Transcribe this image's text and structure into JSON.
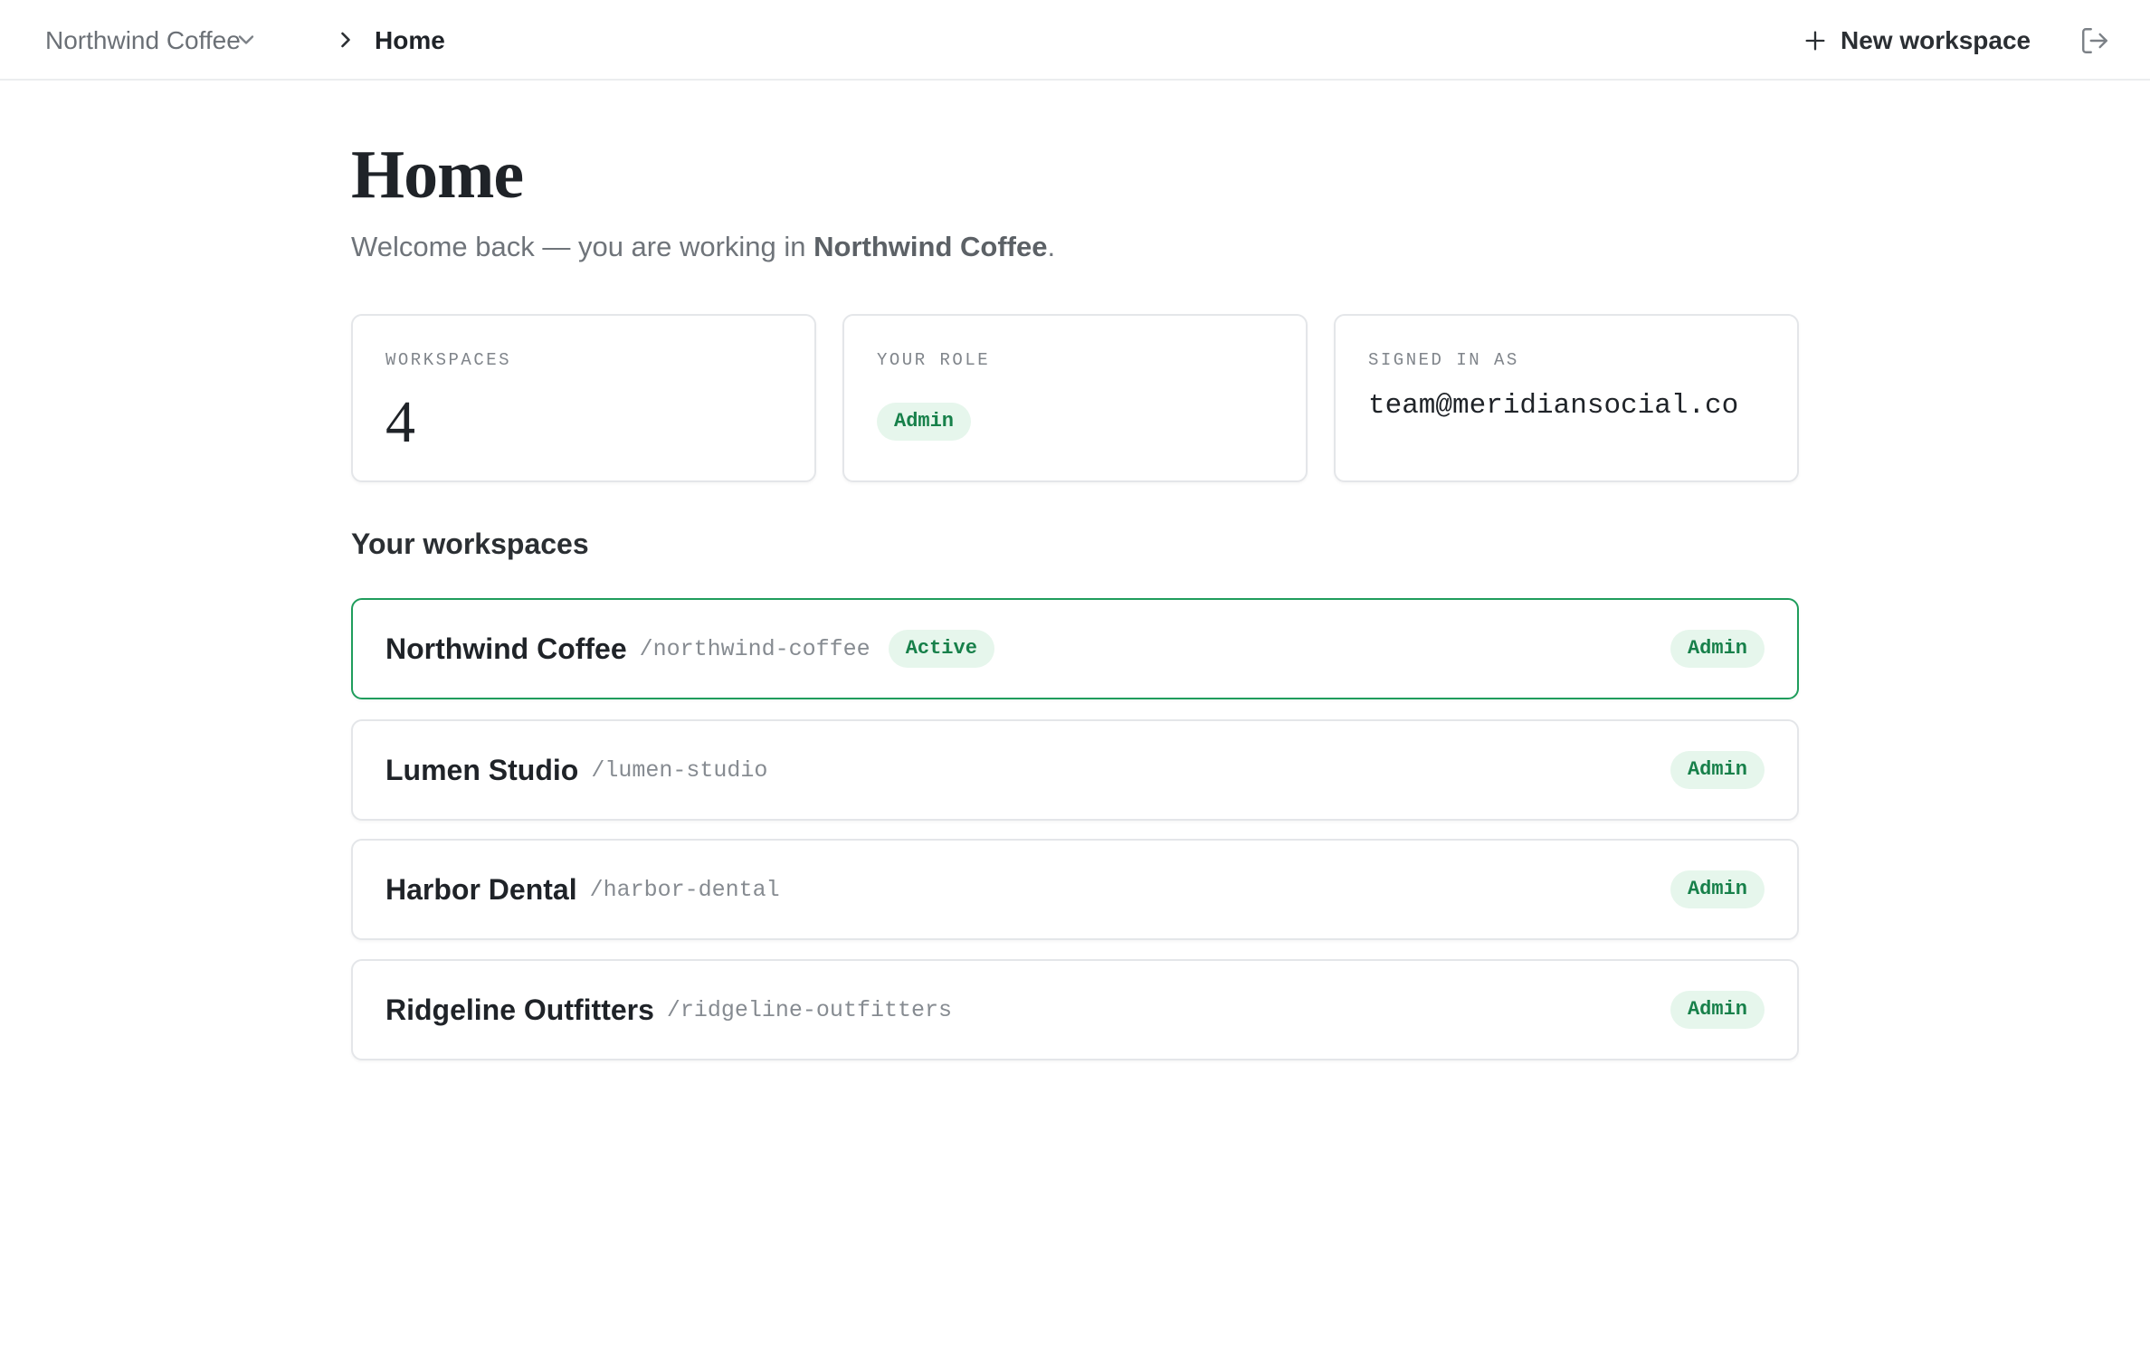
{
  "topbar": {
    "workspace_switcher": "Northwind Coffee",
    "breadcrumb_current": "Home",
    "new_workspace_label": "New workspace"
  },
  "page": {
    "title": "Home",
    "subtitle_prefix": "Welcome back — you are working in ",
    "subtitle_workspace": "Northwind Coffee",
    "subtitle_suffix": "."
  },
  "stats": {
    "workspaces_label": "WORKSPACES",
    "workspaces_count": "4",
    "role_label": "YOUR ROLE",
    "role_value": "Admin",
    "signed_in_label": "SIGNED IN AS",
    "signed_in_email": "team@meridiansocial.co"
  },
  "workspaces_section": {
    "title": "Your workspaces",
    "items": [
      {
        "name": "Northwind Coffee",
        "slug": "/northwind-coffee",
        "status": "Active",
        "role": "Admin"
      },
      {
        "name": "Lumen Studio",
        "slug": "/lumen-studio",
        "status": "",
        "role": "Admin"
      },
      {
        "name": "Harbor Dental",
        "slug": "/harbor-dental",
        "status": "",
        "role": "Admin"
      },
      {
        "name": "Ridgeline Outfitters",
        "slug": "/ridgeline-outfitters",
        "status": "",
        "role": "Admin"
      }
    ]
  },
  "icons": {
    "switcher": "chevron-down-icon",
    "separator": "chevron-right-icon",
    "new": "plus-icon",
    "signout": "logout-icon"
  },
  "colors": {
    "accent_green": "#1f9d5c",
    "badge_bg": "#e6f6ec",
    "badge_text": "#17804a"
  }
}
